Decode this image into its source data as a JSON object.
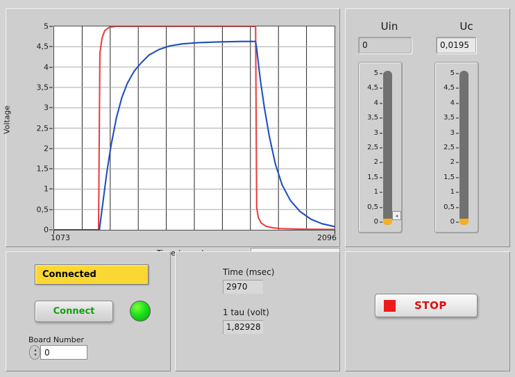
{
  "graph": {
    "y_axis_title": "Voltage",
    "x_axis_title": "Time (msec)",
    "x_min_label": "1073",
    "x_max_label": "2096",
    "y_ticks": [
      "5",
      "4,5",
      "4",
      "3,5",
      "3",
      "2,5",
      "2",
      "1,5",
      "1",
      "0,5",
      "0"
    ],
    "scroll_left_icon": "◂",
    "scroll_right_icon": "▸"
  },
  "chart_data": {
    "type": "line",
    "title": "",
    "xlabel": "Time (msec)",
    "ylabel": "Voltage",
    "xlim": [
      1073,
      2096
    ],
    "ylim": [
      0,
      5
    ],
    "grid": true,
    "legend": "none",
    "y_ticks": [
      0,
      0.5,
      1,
      1.5,
      2,
      2.5,
      3,
      3.5,
      4,
      4.5,
      5
    ],
    "x_tick_labels": [
      1073,
      2096
    ],
    "series": [
      {
        "name": "Uin",
        "color": "#e8413f",
        "description": "Square-wave input pulse: 0 V until ~1238 ms, steps to 5 V, holds until ~1810 ms, then decays back toward 0 V",
        "x": [
          1073,
          1150,
          1225,
          1235,
          1240,
          1248,
          1258,
          1275,
          1300,
          1400,
          1500,
          1600,
          1700,
          1800,
          1808,
          1812,
          1818,
          1828,
          1845,
          1870,
          1900,
          1950,
          2000,
          2050,
          2096
        ],
        "y": [
          0,
          0,
          0,
          0,
          4.35,
          4.72,
          4.9,
          4.98,
          5,
          5,
          5,
          5,
          5,
          5,
          5,
          0.55,
          0.3,
          0.17,
          0.09,
          0.05,
          0.03,
          0.02,
          0.015,
          0.012,
          0.01
        ]
      },
      {
        "name": "Uc",
        "color": "#1d4fc4",
        "description": "Capacitor charging/discharging exponential: rises from 0 V toward 4.63 V after the step at ~1238 ms, then discharges after ~1810 ms",
        "x": [
          1073,
          1150,
          1225,
          1238,
          1250,
          1265,
          1280,
          1300,
          1320,
          1340,
          1365,
          1390,
          1420,
          1455,
          1495,
          1540,
          1600,
          1680,
          1760,
          1808,
          1812,
          1825,
          1840,
          1858,
          1880,
          1905,
          1935,
          1970,
          2010,
          2050,
          2096
        ],
        "y": [
          0,
          0,
          0,
          0,
          0.62,
          1.4,
          2.05,
          2.75,
          3.25,
          3.6,
          3.9,
          4.1,
          4.3,
          4.43,
          4.52,
          4.57,
          4.6,
          4.62,
          4.63,
          4.63,
          4.45,
          3.7,
          3.0,
          2.3,
          1.62,
          1.1,
          0.72,
          0.45,
          0.26,
          0.15,
          0.08
        ]
      }
    ]
  },
  "meters": {
    "uin": {
      "title": "Uin",
      "value": "0",
      "gauge_value": 0,
      "gauge_min": 0,
      "gauge_max": 5,
      "ticks": [
        "5",
        "4,5",
        "4",
        "3,5",
        "3",
        "2,5",
        "2",
        "1,5",
        "1",
        "0,5",
        "0"
      ],
      "pointer_icon": "◂"
    },
    "uc": {
      "title": "Uc",
      "value": "0,0195",
      "gauge_value": 0.0195,
      "gauge_min": 0,
      "gauge_max": 5,
      "ticks": [
        "5",
        "4,5",
        "4",
        "3,5",
        "3",
        "2,5",
        "2",
        "1,5",
        "1",
        "0,5",
        "0"
      ]
    }
  },
  "connect": {
    "status": "Connected",
    "button_label": "Connect",
    "led_state": "on",
    "board_number_label": "Board Number",
    "board_number_value": "0",
    "spinner_up_icon": "▴",
    "spinner_down_icon": "▾"
  },
  "measurements": {
    "time_label": "Time (msec)",
    "time_value": "2970",
    "tau_label": "1 tau (volt)",
    "tau_value": "1,82928"
  },
  "stop": {
    "label": "STOP"
  },
  "colors": {
    "background": "#d3d3d3",
    "panel": "#cecece",
    "uin_trace": "#e8413f",
    "uc_trace": "#1d4fc4",
    "status_banner": "#fbd733",
    "led_on": "#1be11b",
    "stop_red": "#e10e0e",
    "gauge_fill": "#f6b01e",
    "gauge_track": "#717171"
  }
}
